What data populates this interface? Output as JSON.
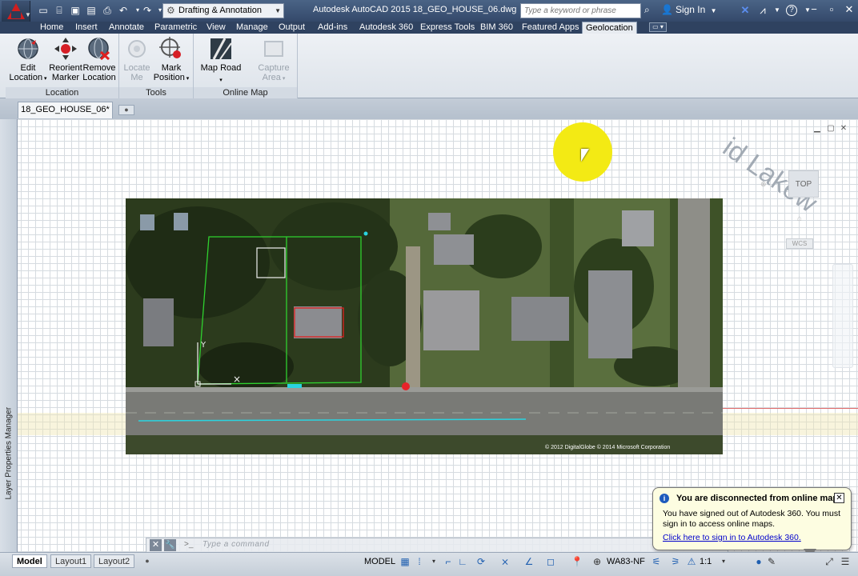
{
  "title_bar": {
    "workspace": "Drafting & Annotation",
    "document_title": "Autodesk AutoCAD 2015   18_GEO_HOUSE_06.dwg",
    "search_placeholder": "Type a keyword or phrase",
    "sign_in": "Sign In"
  },
  "ribbon_tabs": [
    "Home",
    "Insert",
    "Annotate",
    "Parametric",
    "View",
    "Manage",
    "Output",
    "Add-ins",
    "Autodesk 360",
    "Express Tools",
    "BIM 360",
    "Featured Apps",
    "Geolocation"
  ],
  "active_tab": "Geolocation",
  "ribbon": {
    "location_panel": {
      "title": "Location",
      "edit_location": [
        "Edit",
        "Location"
      ],
      "reorient_marker": [
        "Reorient",
        "Marker"
      ],
      "remove_location": [
        "Remove",
        "Location"
      ]
    },
    "tools_panel": {
      "title": "Tools",
      "locate_me": [
        "Locate",
        "Me"
      ],
      "mark_position": [
        "Mark",
        "Position"
      ]
    },
    "online_map_panel": {
      "title": "Online Map",
      "map_road": "Map Road",
      "capture_area": [
        "Capture",
        "Area"
      ]
    }
  },
  "file_tab": "18_GEO_HOUSE_06*",
  "palette_label": "Layer Properties Manager",
  "viewcube": {
    "face": "TOP",
    "wcs": "WCS"
  },
  "map": {
    "credit": "© 2012 DigitalGlobe © 2014 Microsoft Corporation"
  },
  "command_line": {
    "prompt": ">_",
    "placeholder": "Type a command"
  },
  "notification": {
    "title": "You are disconnected from online maps",
    "body": "You have signed out of Autodesk 360. You must sign in to access online maps.",
    "link": "Click here to sign in to Autodesk 360."
  },
  "layout_tabs": [
    "Model",
    "Layout1",
    "Layout2"
  ],
  "status_bar": {
    "space": "MODEL",
    "coordinate_system": "WA83-NF",
    "annotation_scale": "1:1"
  },
  "colors": {
    "title_bar": "#34496a",
    "ribbon_bg": "#e7ebf0",
    "boundary_green": "#2fd12f",
    "building_red": "#e02020",
    "road_cyan": "#2ad4e0",
    "marker_red": "#e8232a",
    "cursor_highlight": "#f3ea14"
  }
}
